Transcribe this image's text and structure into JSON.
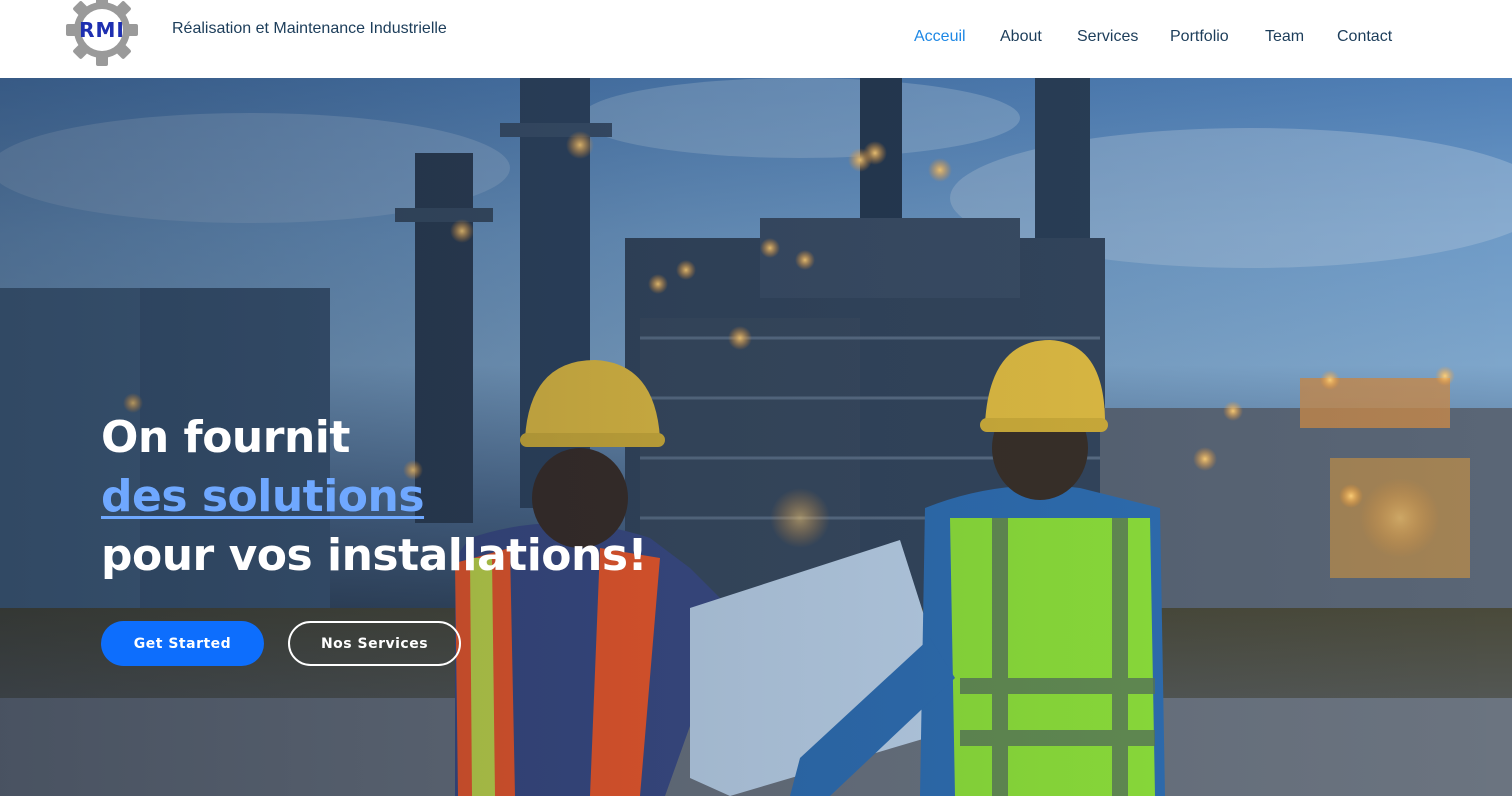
{
  "header": {
    "logo_text": "RMI",
    "tagline": "Réalisation et Maintenance Industrielle",
    "nav": [
      {
        "label": "Acceuil",
        "active": true
      },
      {
        "label": "About",
        "active": false
      },
      {
        "label": "Services",
        "active": false
      },
      {
        "label": "Portfolio",
        "active": false
      },
      {
        "label": "Team",
        "active": false
      },
      {
        "label": "Contact",
        "active": false
      }
    ]
  },
  "hero": {
    "title_line1": "On fournit",
    "title_line2": "des solutions",
    "title_line3": "pour vos installations!",
    "primary_button": "Get Started",
    "secondary_button": "Nos Services"
  },
  "colors": {
    "accent": "#1e88e5",
    "primary_button": "#0d6efd",
    "highlight_text": "#6fa8ff",
    "nav_text": "#1c3d5a",
    "logo_text": "#1e2fb0"
  }
}
